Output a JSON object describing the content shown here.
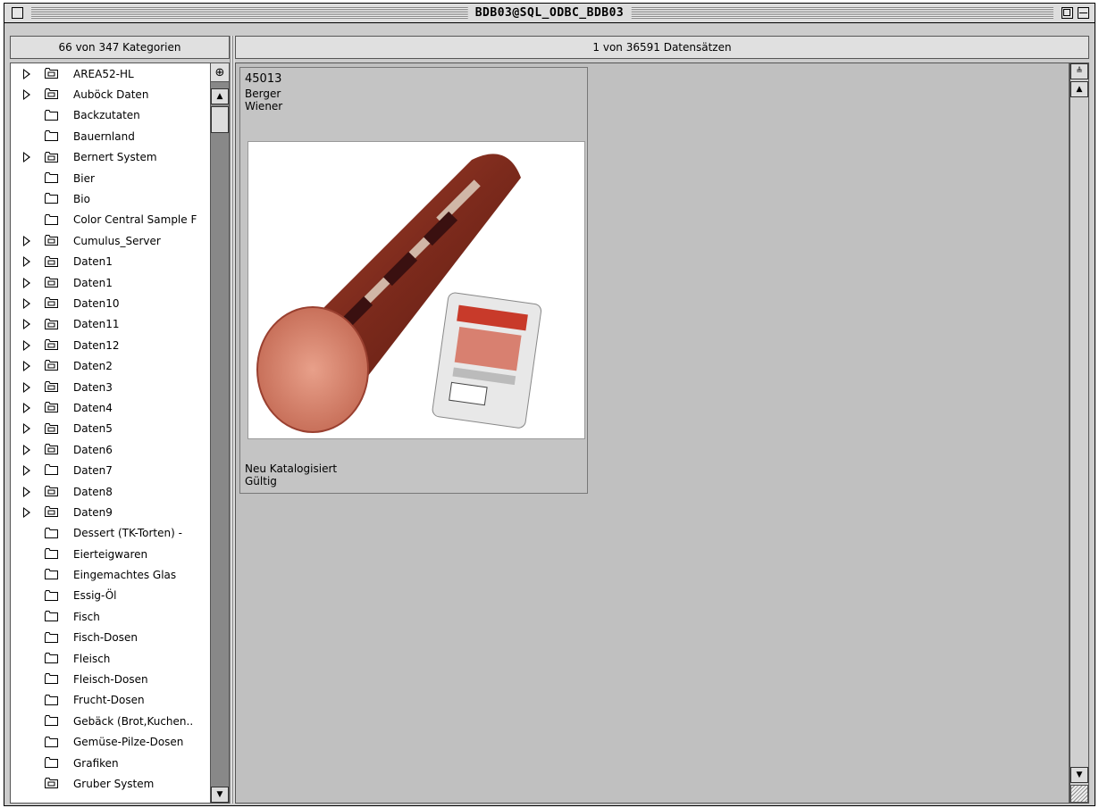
{
  "window": {
    "title": "BDB03@SQL_ODBC_BDB03"
  },
  "left_pane": {
    "header": "66 von 347 Kategorien",
    "items": [
      {
        "label": "AREA52-HL",
        "expandable": true,
        "icon": "server-folder-icon"
      },
      {
        "label": "Auböck Daten",
        "expandable": true,
        "icon": "server-folder-icon"
      },
      {
        "label": "Backzutaten",
        "expandable": false,
        "icon": "folder-icon"
      },
      {
        "label": "Bauernland",
        "expandable": false,
        "icon": "folder-icon"
      },
      {
        "label": "Bernert System",
        "expandable": true,
        "icon": "server-folder-icon"
      },
      {
        "label": "Bier",
        "expandable": false,
        "icon": "folder-icon"
      },
      {
        "label": "Bio",
        "expandable": false,
        "icon": "folder-icon"
      },
      {
        "label": "Color Central Sample F",
        "expandable": false,
        "icon": "folder-icon"
      },
      {
        "label": "Cumulus_Server",
        "expandable": true,
        "icon": "server-folder-icon"
      },
      {
        "label": "Daten1",
        "expandable": true,
        "icon": "server-folder-icon"
      },
      {
        "label": "Daten1",
        "expandable": true,
        "icon": "server-folder-icon"
      },
      {
        "label": "Daten10",
        "expandable": true,
        "icon": "server-folder-icon"
      },
      {
        "label": "Daten11",
        "expandable": true,
        "icon": "server-folder-icon"
      },
      {
        "label": "Daten12",
        "expandable": true,
        "icon": "server-folder-icon"
      },
      {
        "label": "Daten2",
        "expandable": true,
        "icon": "server-folder-icon"
      },
      {
        "label": "Daten3",
        "expandable": true,
        "icon": "server-folder-icon"
      },
      {
        "label": "Daten4",
        "expandable": true,
        "icon": "server-folder-icon"
      },
      {
        "label": "Daten5",
        "expandable": true,
        "icon": "server-folder-icon"
      },
      {
        "label": "Daten6",
        "expandable": true,
        "icon": "server-folder-icon"
      },
      {
        "label": "Daten7",
        "expandable": true,
        "icon": "folder-icon"
      },
      {
        "label": "Daten8",
        "expandable": true,
        "icon": "server-folder-icon"
      },
      {
        "label": "Daten9",
        "expandable": true,
        "icon": "server-folder-icon"
      },
      {
        "label": "Dessert (TK-Torten) -",
        "expandable": false,
        "icon": "folder-icon"
      },
      {
        "label": "Eierteigwaren",
        "expandable": false,
        "icon": "folder-icon"
      },
      {
        "label": "Eingemachtes Glas",
        "expandable": false,
        "icon": "folder-icon"
      },
      {
        "label": "Essig-Öl",
        "expandable": false,
        "icon": "folder-icon"
      },
      {
        "label": "Fisch",
        "expandable": false,
        "icon": "folder-icon"
      },
      {
        "label": "Fisch-Dosen",
        "expandable": false,
        "icon": "folder-icon"
      },
      {
        "label": "Fleisch",
        "expandable": false,
        "icon": "folder-icon"
      },
      {
        "label": "Fleisch-Dosen",
        "expandable": false,
        "icon": "folder-icon"
      },
      {
        "label": "Frucht-Dosen",
        "expandable": false,
        "icon": "folder-icon"
      },
      {
        "label": "Gebäck (Brot,Kuchen..",
        "expandable": false,
        "icon": "folder-icon"
      },
      {
        "label": "Gemüse-Pilze-Dosen",
        "expandable": false,
        "icon": "folder-icon"
      },
      {
        "label": "Grafiken",
        "expandable": false,
        "icon": "folder-icon"
      },
      {
        "label": "Gruber System",
        "expandable": false,
        "icon": "server-folder-icon"
      }
    ]
  },
  "right_pane": {
    "header": "1 von 36591 Datensätzen",
    "record": {
      "id": "45013",
      "line2": "Berger",
      "line3": "Wiener",
      "status1": "Neu Katalogisiert",
      "status2": "Gültig",
      "thumbnail": "sausage-product-image"
    }
  }
}
